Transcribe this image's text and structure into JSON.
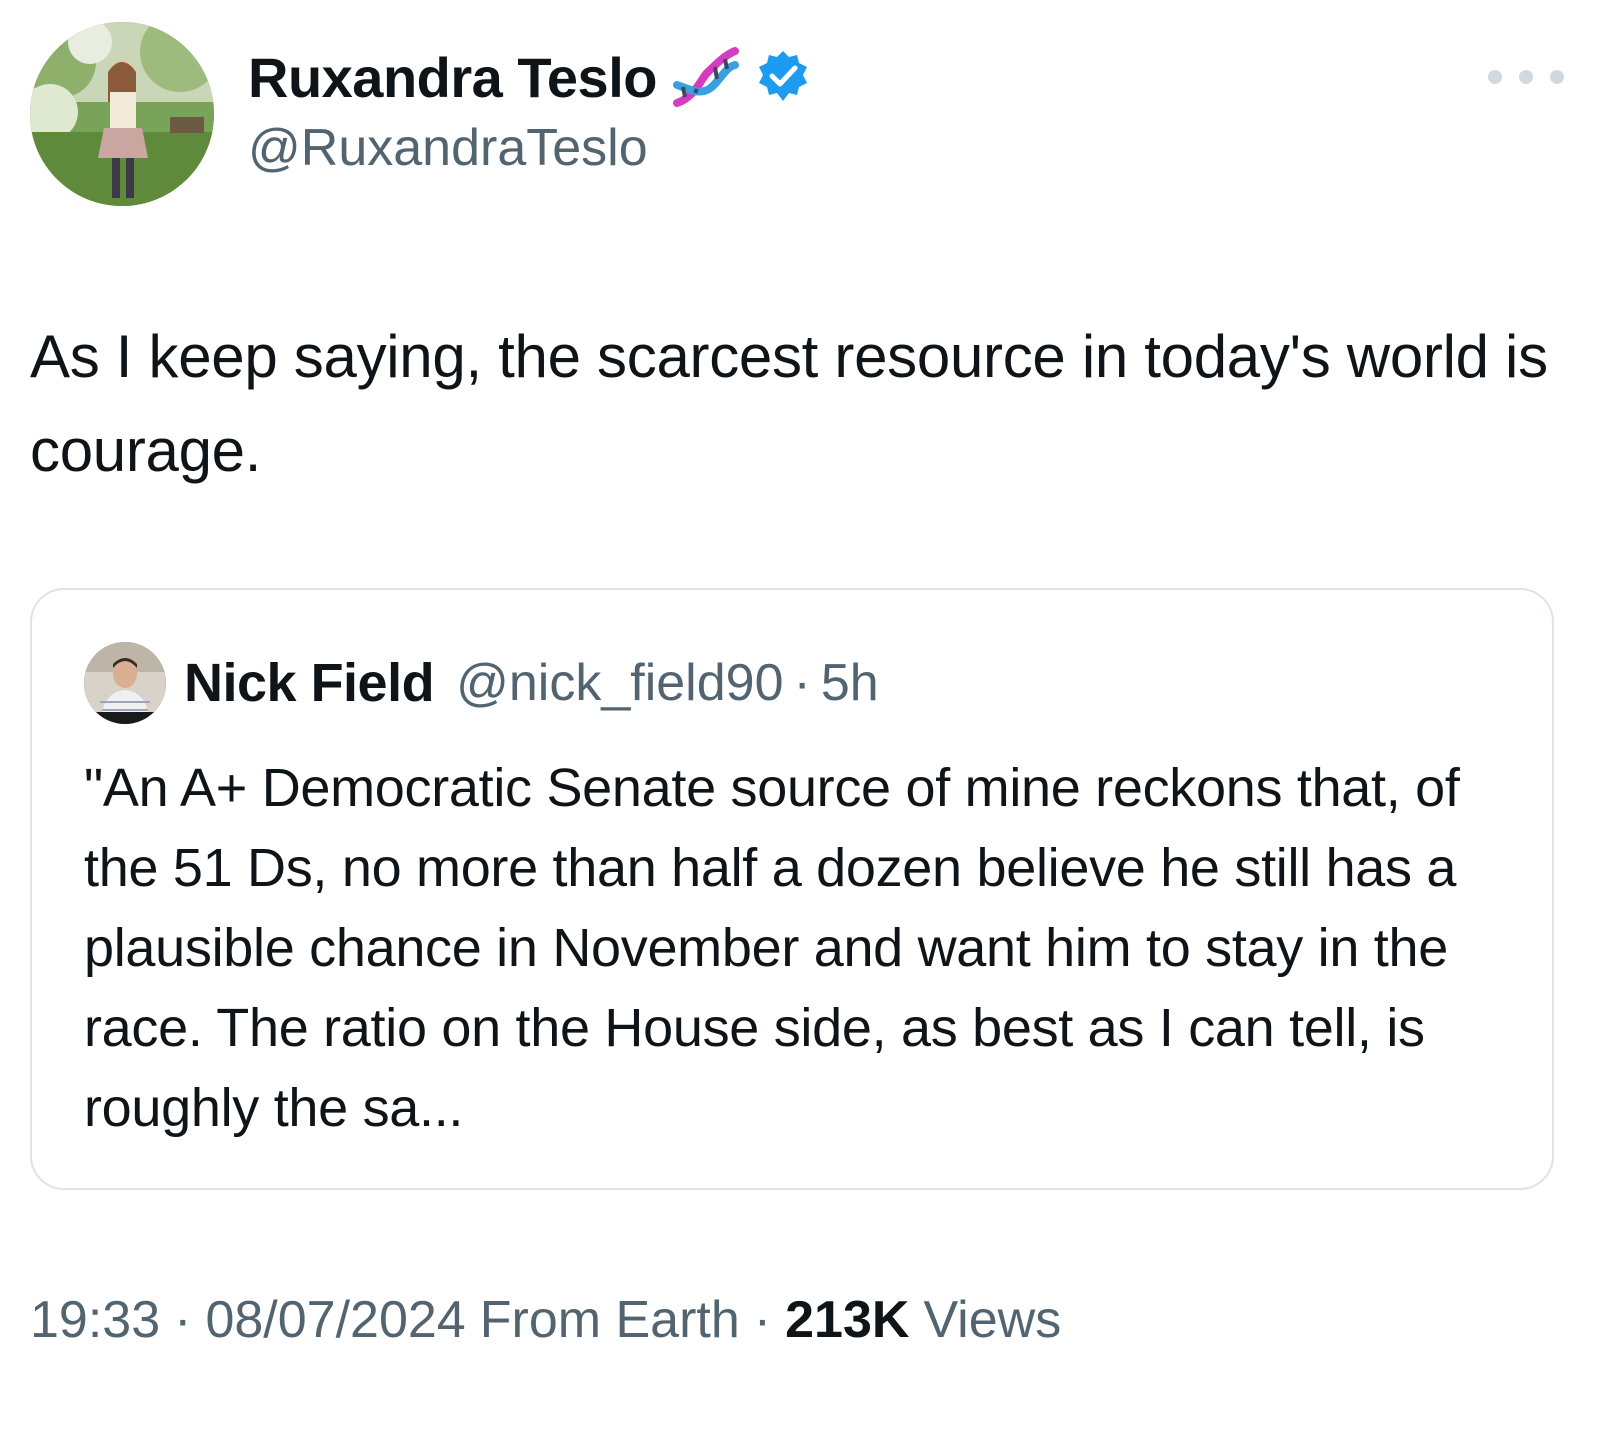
{
  "author": {
    "display_name": "Ruxandra Teslo",
    "handle": "@RuxandraTeslo",
    "name_emoji": "dna-icon",
    "verified_icon": "verified-badge-icon",
    "verified_color": "#1d9bf0"
  },
  "tweet": {
    "text": "As I keep saying, the scarcest resource in today's world is courage."
  },
  "quote": {
    "display_name": "Nick Field",
    "handle": "@nick_field90",
    "separator": "·",
    "time": "5h",
    "text": "\"An A+ Democratic Senate source of mine reckons that, of the 51 Ds, no more than half a dozen believe he still has a plausible chance in November and want him to stay in the race. The ratio on the House side, as best as I can tell, is roughly the sa..."
  },
  "meta": {
    "time": "19:33",
    "date": "08/07/2024",
    "source": "From Earth",
    "separator": "·",
    "views_count": "213K",
    "views_label": "Views"
  },
  "colors": {
    "text_primary": "#0f1419",
    "text_secondary": "#536471",
    "border": "#dde3e7"
  }
}
